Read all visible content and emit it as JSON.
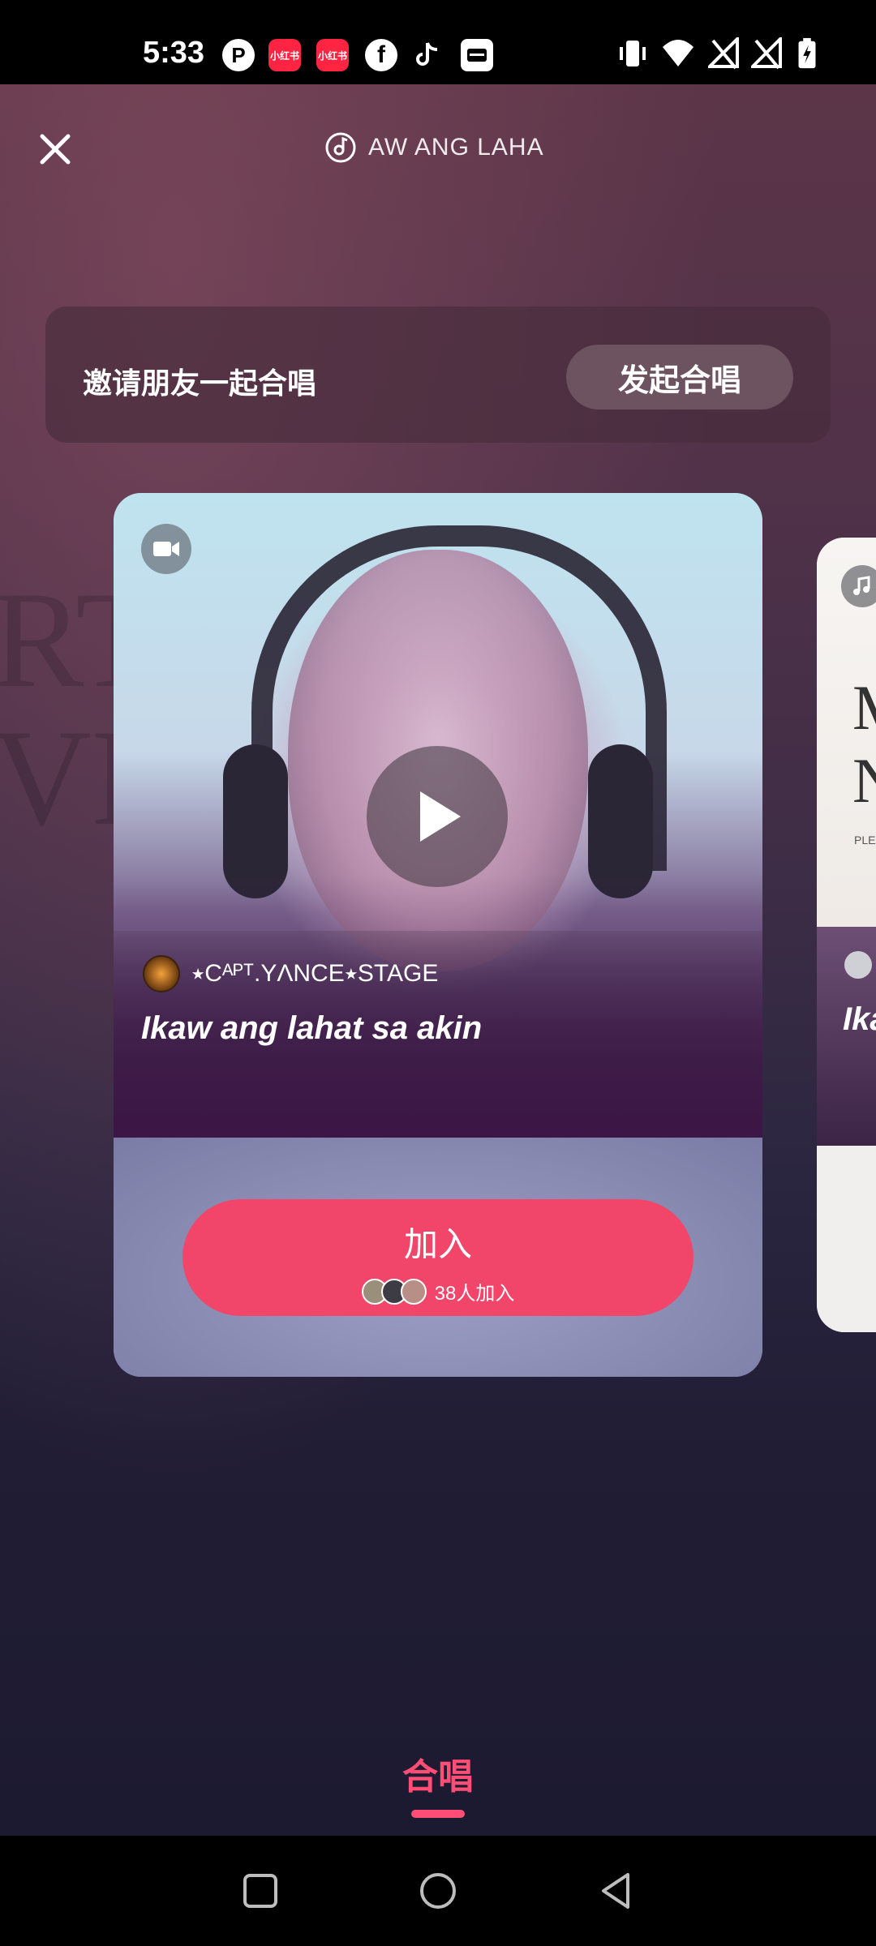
{
  "status_bar": {
    "time": "5:33",
    "app_icons": [
      "p-icon",
      "xiaohongshu-icon",
      "xiaohongshu-icon",
      "facebook-icon",
      "tiktok-icon",
      "wallet-icon"
    ],
    "xiaohongshu_label": "小红书",
    "right_icons": [
      "vibrate-icon",
      "wifi-icon",
      "no-signal-icon",
      "no-signal-icon",
      "battery-charging-icon"
    ]
  },
  "header": {
    "close_icon": "close-icon",
    "song_title": "AW ANG LAHA"
  },
  "invite": {
    "text": "邀请朋友一起合唱",
    "button_label": "发起合唱"
  },
  "card": {
    "creator": "⭑Cᴬᴾᵀ.YΛNCE⭑STAGE",
    "lyric": "Ikaw ang lahat sa akin",
    "join_label": "加入",
    "joined_count": "38人加入"
  },
  "card2": {
    "letter": "M\nN",
    "small_text": "PLEA",
    "lyric": "Ika"
  },
  "bottom_tab": {
    "label": "合唱"
  },
  "colors": {
    "accent": "#f1456a",
    "tab_active": "#ff4e76"
  }
}
